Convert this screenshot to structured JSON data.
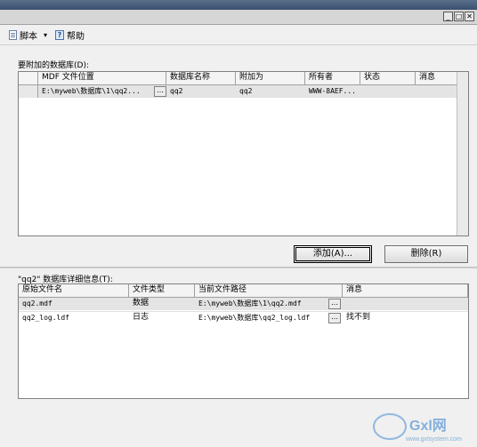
{
  "window": {
    "controls": [
      "_",
      "□",
      "✕"
    ]
  },
  "toolbar": {
    "script_label": "脚本",
    "script_caret": "▾",
    "help_label": "帮助"
  },
  "attach_section": {
    "label": "要附加的数据库(D):",
    "columns": [
      "MDF 文件位置",
      "数据库名称",
      "附加为",
      "所有者",
      "状态",
      "消息"
    ],
    "rows": [
      {
        "mdf": "E:\\myweb\\数据库\\1\\qq2...",
        "db_name": "qq2",
        "attach_as": "qq2",
        "owner": "WWW-8AEF...",
        "status": "",
        "message": ""
      }
    ],
    "add_button": "添加(A)...",
    "remove_button": "删除(R)"
  },
  "detail_section": {
    "label": "\"qq2\" 数据库详细信息(T):",
    "columns": [
      "原始文件名",
      "文件类型",
      "当前文件路径",
      "消息"
    ],
    "rows": [
      {
        "file": "qq2.mdf",
        "type": "数据",
        "path": "E:\\myweb\\数据库\\1\\qq2.mdf",
        "message": ""
      },
      {
        "file": "qq2_log.ldf",
        "type": "日志",
        "path": "E:\\myweb\\数据库\\qq2_log.ldf",
        "message": "找不到"
      }
    ]
  },
  "watermark": {
    "text": "Gxl网",
    "subtext": "www.gxlsystem.com"
  },
  "colors": {
    "titlebar": "#3a5070",
    "grid_border": "#808080",
    "watermark": "#6aa0d8"
  }
}
